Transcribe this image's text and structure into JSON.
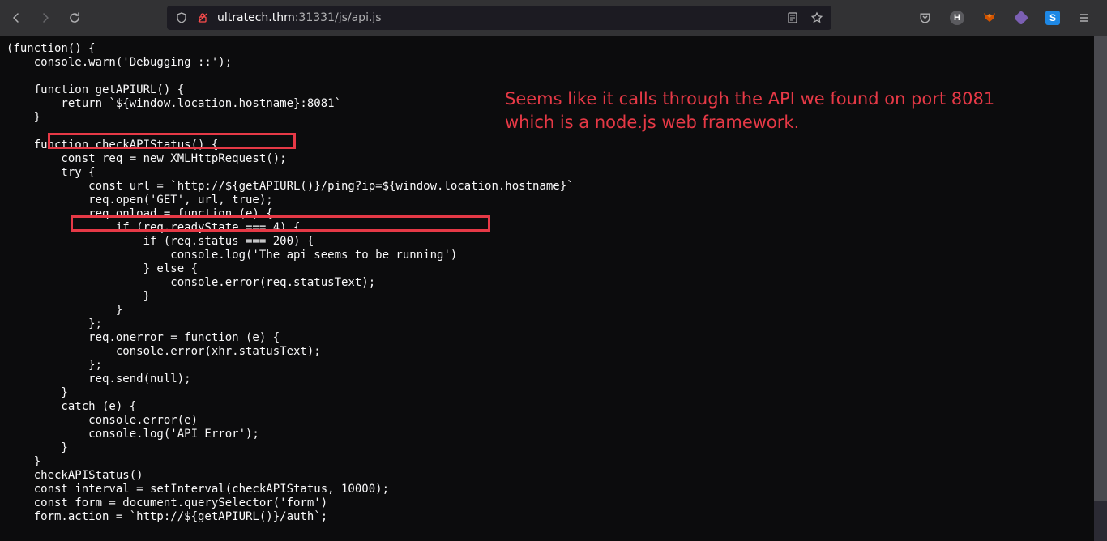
{
  "toolbar": {
    "url_domain": "ultratech.thm",
    "url_port": ":31331",
    "url_path": "/js/api.js"
  },
  "annotation": "Seems like it calls through the API we found on port 8081 which is a node.js web framework.",
  "code": "(function() {\n    console.warn('Debugging ::');\n\n    function getAPIURL() {\n        return `${window.location.hostname}:8081`\n    }\n\n    function checkAPIStatus() {\n        const req = new XMLHttpRequest();\n        try {\n            const url = `http://${getAPIURL()}/ping?ip=${window.location.hostname}`\n            req.open('GET', url, true);\n            req.onload = function (e) {\n                if (req.readyState === 4) {\n                    if (req.status === 200) {\n                        console.log('The api seems to be running')\n                    } else {\n                        console.error(req.statusText);\n                    }\n                }\n            };\n            req.onerror = function (e) {\n                console.error(xhr.statusText);\n            };\n            req.send(null);\n        }\n        catch (e) {\n            console.error(e)\n            console.log('API Error');\n        }\n    }\n    checkAPIStatus()\n    const interval = setInterval(checkAPIStatus, 10000);\n    const form = document.querySelector('form')\n    form.action = `http://${getAPIURL()}/auth`;"
}
